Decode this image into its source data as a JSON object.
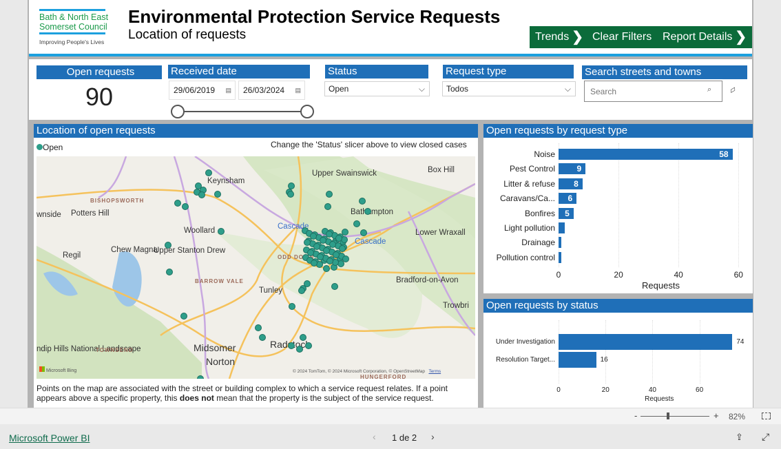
{
  "logo": {
    "line1": "Bath & North East",
    "line2": "Somerset Council",
    "tagline": "Improving People's Lives"
  },
  "header": {
    "title": "Environmental Protection Service Requests",
    "subtitle": "Location of requests"
  },
  "buttons": {
    "trends": "Trends",
    "clear": "Clear Filters",
    "details": "Report Details"
  },
  "kpi": {
    "label": "Open requests",
    "value": "90"
  },
  "received": {
    "label": "Received date",
    "from": "29/06/2019",
    "to": "26/03/2024"
  },
  "status": {
    "label": "Status",
    "value": "Open"
  },
  "reqtype": {
    "label": "Request type",
    "value": "Todos"
  },
  "search": {
    "label": "Search streets and towns",
    "placeholder": "Search"
  },
  "map": {
    "title": "Location of open requests",
    "legend": "Open",
    "hint": "Change the 'Status' slicer above to view closed cases",
    "places": [
      "Keynsham",
      "Upper Swainswick",
      "Box Hill",
      "Bathampton",
      "Potters Hill",
      "Woollard",
      "Chew Magna",
      "Upper Stanton Drew",
      "Regil",
      "Lower Wraxall",
      "Bradford-on-Avon",
      "Tunley",
      "Trowbri",
      "Midsomer",
      "Norton",
      "Radstock",
      "ndip Hills National Landscape",
      "wnside",
      "Cascade",
      "Cascade"
    ],
    "districts": [
      "BISHOPSWORTH",
      "ODD DOWN",
      "BARROW VALE",
      "TOWNSEND",
      "HUNGERFORD"
    ],
    "bing": "Microsoft Bing",
    "attribution": "© 2024 TomTom, © 2024 Microsoft Corporation, © OpenStreetMap",
    "terms": "Terms",
    "note_a": "Points on the map are associated with the street or building complex to which a service request relates. If a point appears above a specific property, this ",
    "note_b": "does not",
    "note_c": " mean that the property is the subject of the service request.",
    "dot_color": "#2e9e8a"
  },
  "chart_data": [
    {
      "type": "bar",
      "title": "Open requests by request type",
      "categories": [
        "Noise",
        "Pest Control",
        "Litter & refuse",
        "Caravans/Ca...",
        "Bonfires",
        "Light pollution",
        "Drainage",
        "Pollution control"
      ],
      "values": [
        58,
        9,
        8,
        6,
        5,
        2,
        1,
        1
      ],
      "data_labels": [
        "58",
        "9",
        "8",
        "6",
        "5",
        "",
        "",
        ""
      ],
      "xlabel": "Requests",
      "xticks": [
        "0",
        "20",
        "40",
        "60"
      ],
      "xlim": [
        0,
        62
      ],
      "color": "#1f6fb8"
    },
    {
      "type": "bar",
      "title": "Open requests by status",
      "categories": [
        "Under Investigation",
        "Resolution Target..."
      ],
      "values": [
        74,
        16
      ],
      "data_labels": [
        "74",
        "16"
      ],
      "xlabel": "Requests",
      "xticks": [
        "0",
        "20",
        "40",
        "60"
      ],
      "xlim": [
        0,
        78
      ],
      "color": "#1f6fb8"
    }
  ],
  "footer": {
    "zoom": "82%",
    "minus": "-",
    "plus": "+",
    "brand": "Microsoft Power BI",
    "page": "1 de 2"
  }
}
